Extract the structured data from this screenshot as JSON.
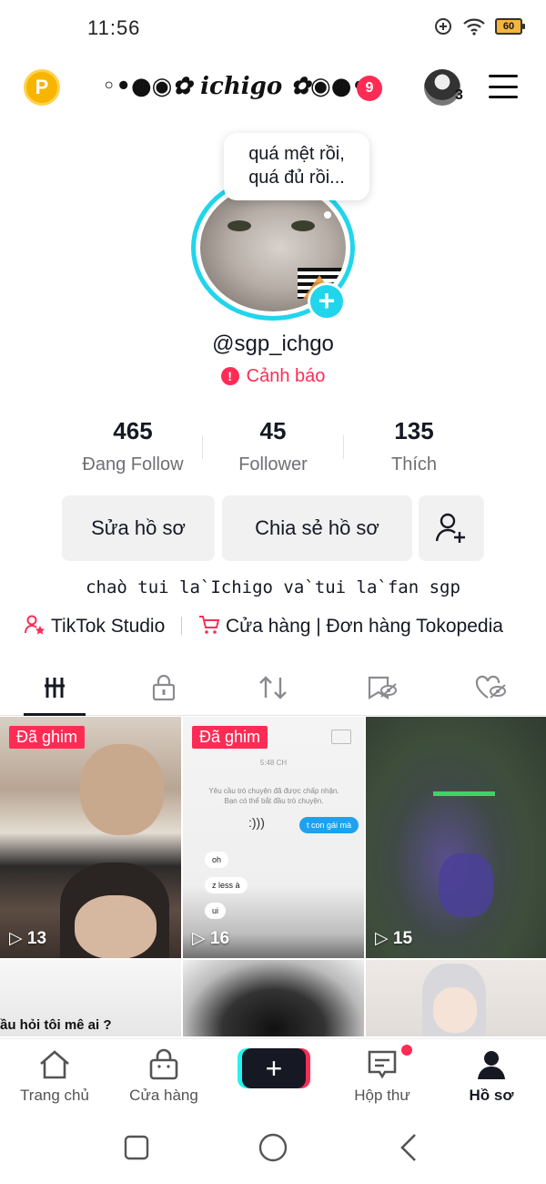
{
  "status_bar": {
    "time": "11:56",
    "battery": "60"
  },
  "header": {
    "nickname": "◦•●◉✿ ichigo ✿◉●•◦",
    "notification_count": "9",
    "coin_label": "P",
    "account_count": "3"
  },
  "profile": {
    "note": "quá mệt rồi,\nquá đủ rồi...",
    "username": "@sgp_ichgo",
    "warning": "Cảnh báo",
    "stats": [
      {
        "value": "465",
        "label": "Đang Follow"
      },
      {
        "value": "45",
        "label": "Follower"
      },
      {
        "value": "135",
        "label": "Thích"
      }
    ],
    "buttons": {
      "edit": "Sửa hồ sơ",
      "share": "Chia sẻ hồ sơ"
    },
    "bio": "chaò tui la`Ichigo va`tui la`fan sgp",
    "links": {
      "studio": "TikTok Studio",
      "shop": "Cửa hàng | Đơn hàng Tokopedia"
    }
  },
  "videos": [
    {
      "pinned": "Đã ghim",
      "views": "13"
    },
    {
      "pinned": "Đã ghim",
      "views": "16",
      "chat": {
        "time": "5:48 CH",
        "notice": "Yêu cầu trò chuyện đã được chấp nhận. Bạn có thể bắt đầu trò chuyện.",
        "sent": "t con gái mà",
        "received": [
          "oh",
          "z less à",
          "ui"
        ]
      }
    },
    {
      "views": "15"
    },
    {
      "caption": "ầu hỏi tôi mê ai ?"
    },
    {},
    {}
  ],
  "bottom_nav": {
    "home": "Trang chủ",
    "shop": "Cửa hàng",
    "inbox": "Hộp thư",
    "profile": "Hồ sơ"
  },
  "colors": {
    "accent": "#fe2c55",
    "cyan": "#20d5ec"
  }
}
